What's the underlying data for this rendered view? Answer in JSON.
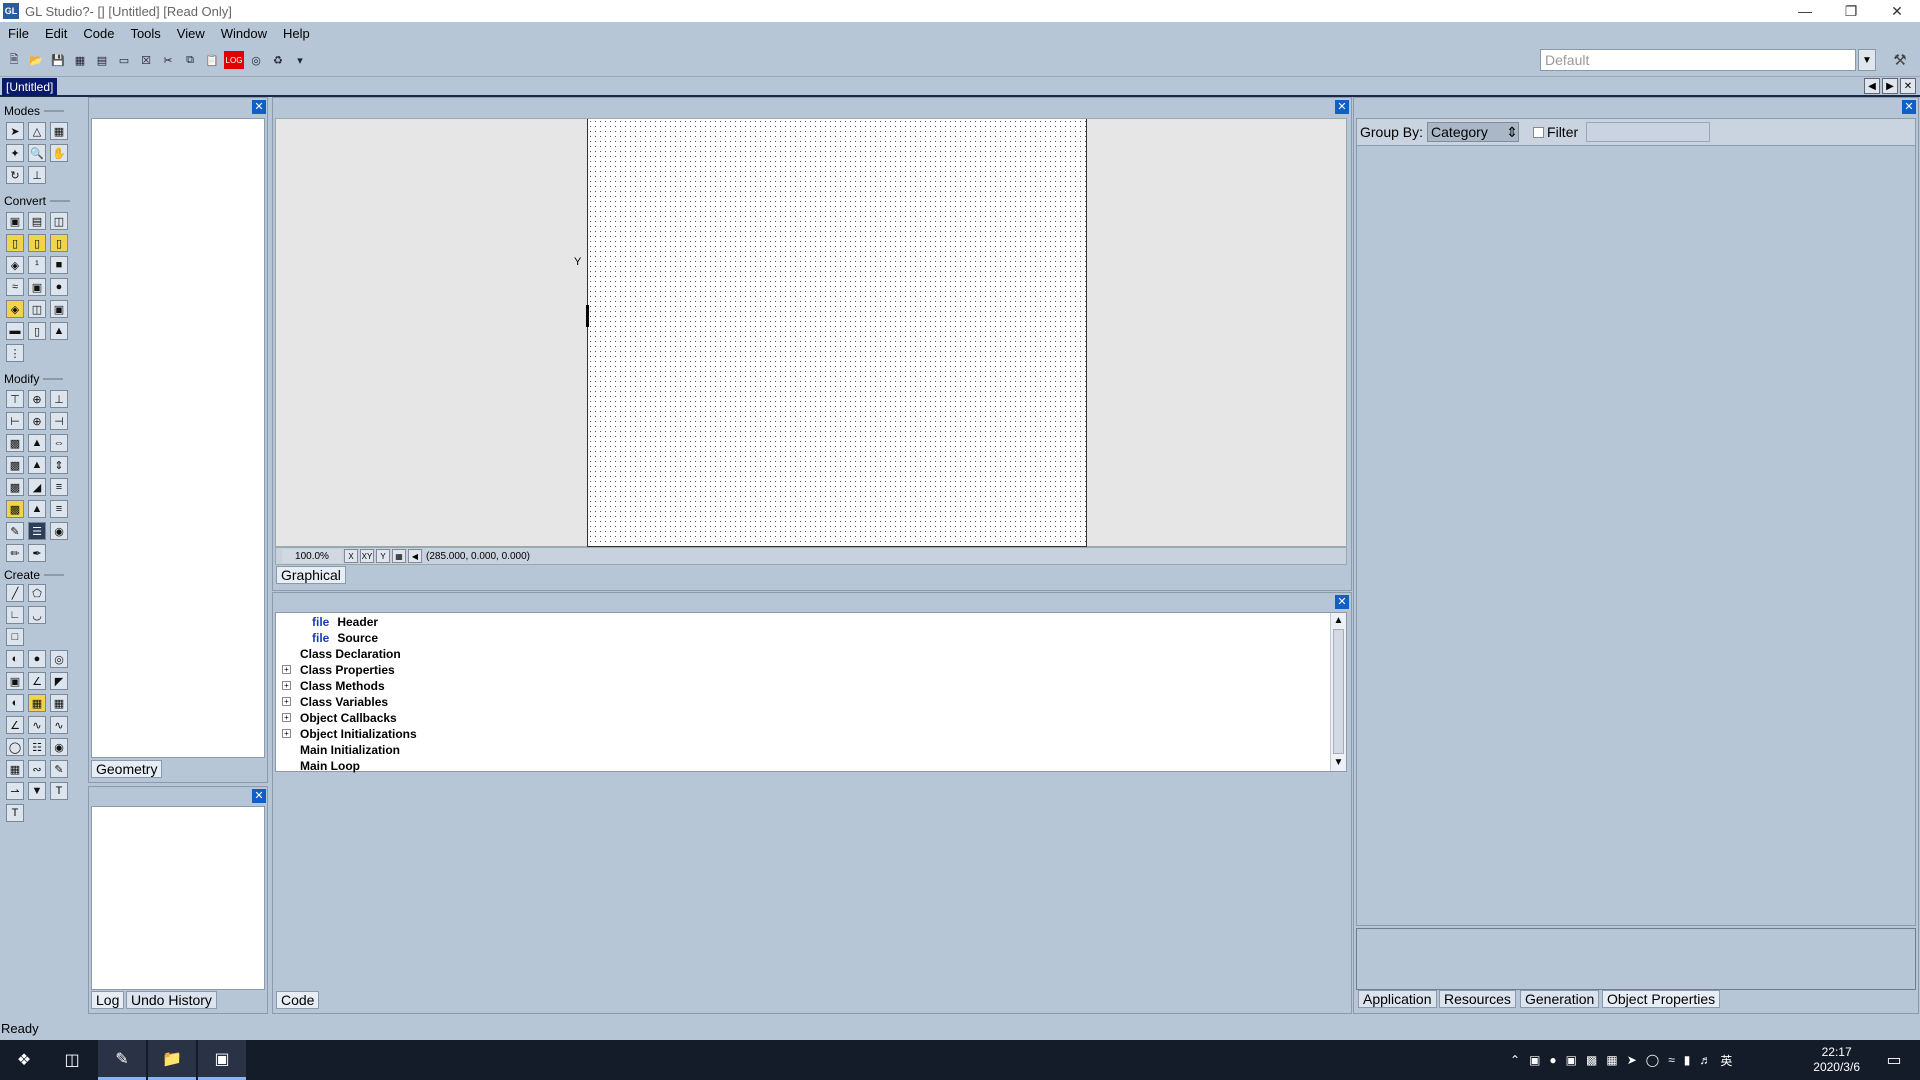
{
  "window": {
    "title": "GL Studio?-  [] [Untitled]  [Read Only]",
    "app_icon_text": "GL",
    "controls": [
      "minimize",
      "restore",
      "close"
    ]
  },
  "menubar": {
    "items": [
      "File",
      "Edit",
      "Code",
      "Tools",
      "View",
      "Window",
      "Help"
    ]
  },
  "toolbar": {
    "preset_value": "Default",
    "icons": [
      "new-file-icon",
      "open-file-icon",
      "save-icon",
      "save-all-icon",
      "properties-icon",
      "copy-doc-icon",
      "close-doc-icon",
      "cut-icon",
      "copy-icon",
      "paste-icon",
      "record-icon",
      "target-icon",
      "run-icon",
      "more-icon"
    ],
    "record_label": "LOG"
  },
  "document_tab": {
    "label": "[Untitled]"
  },
  "palette": {
    "sections": {
      "modes": "Modes",
      "convert": "Convert",
      "modify": "Modify",
      "create": "Create"
    }
  },
  "left_panel_top": {
    "tab": "Geometry"
  },
  "left_panel_bottom": {
    "tabs": [
      "Log",
      "Undo History"
    ]
  },
  "graphical_view": {
    "axis_label": "Y",
    "zoom": "100.0%",
    "coords": "(285.000, 0.000, 0.000)",
    "tab": "Graphical"
  },
  "code_view": {
    "tab": "Code",
    "items": [
      {
        "prefix": "file",
        "label": "Header",
        "expandable": false
      },
      {
        "prefix": "file",
        "label": "Source",
        "expandable": false
      },
      {
        "prefix": "",
        "label": "Class Declaration",
        "expandable": false
      },
      {
        "prefix": "",
        "label": "Class Properties",
        "expandable": true
      },
      {
        "prefix": "",
        "label": "Class Methods",
        "expandable": true
      },
      {
        "prefix": "",
        "label": "Class Variables",
        "expandable": true
      },
      {
        "prefix": "",
        "label": "Object Callbacks",
        "expandable": true
      },
      {
        "prefix": "",
        "label": "Object Initializations",
        "expandable": true
      },
      {
        "prefix": "",
        "label": "Main Initialization",
        "expandable": false
      },
      {
        "prefix": "",
        "label": "Main Loop",
        "expandable": false
      }
    ]
  },
  "properties_panel": {
    "group_by_label": "Group By:",
    "group_by_value": "Category",
    "filter_label": "Filter",
    "tabs": [
      "Application",
      "Resources",
      "Generation",
      "Object Properties"
    ]
  },
  "statusbar": {
    "text": "Ready"
  },
  "taskbar": {
    "time": "22:17",
    "date": "2020/3/6",
    "ime": "英"
  }
}
